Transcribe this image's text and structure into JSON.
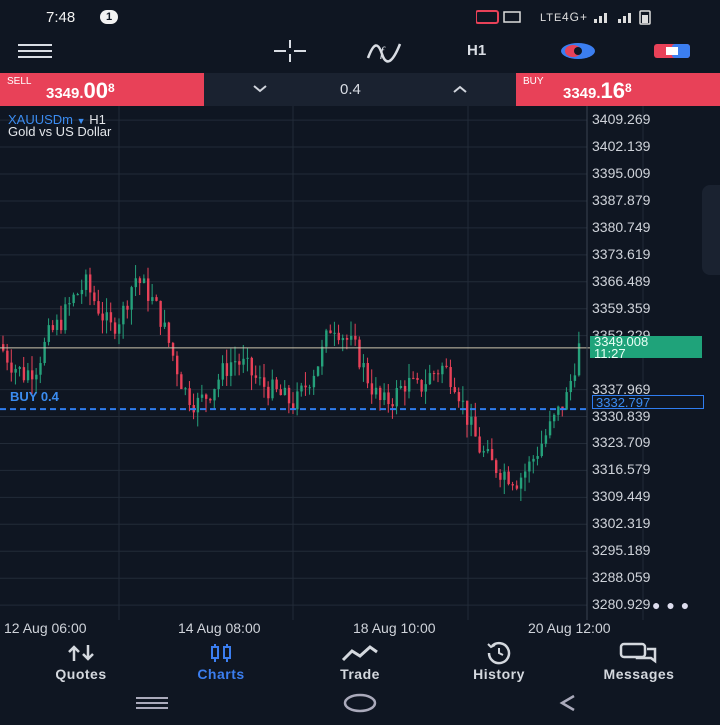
{
  "status_bar": {
    "time": "7:48",
    "notification_count": "1",
    "network": "4G+"
  },
  "toolbar": {
    "timeframe": "H1"
  },
  "trade_bar": {
    "sell_label": "SELL",
    "sell_price_main": "3349.",
    "sell_price_big": "00",
    "sell_price_sup": "8",
    "buy_label": "BUY",
    "buy_price_main": "3349.",
    "buy_price_big": "16",
    "buy_price_sup": "8",
    "volume": "0.4",
    "sell_color": "#e84158",
    "buy_color": "#e84158"
  },
  "chart": {
    "symbol": "XAUUSDm",
    "timeframe": "H1",
    "description": "Gold vs US Dollar",
    "current_price": "3349.008",
    "countdown": "11:27",
    "order_label": "BUY 0.4",
    "order_price": "3332.797",
    "y_ticks": [
      "3409.269",
      "3402.139",
      "3395.009",
      "3387.879",
      "3380.749",
      "3373.619",
      "3366.489",
      "3359.359",
      "3352.229",
      "3337.969",
      "3330.839",
      "3323.709",
      "3316.579",
      "3309.449",
      "3302.319",
      "3295.189",
      "3288.059",
      "3280.929"
    ],
    "x_ticks": [
      "12 Aug 06:00",
      "14 Aug 08:00",
      "18 Aug 10:00",
      "20 Aug 12:00"
    ],
    "up_color": "#25a17b",
    "down_color": "#e84158"
  },
  "chart_data": {
    "type": "candlestick",
    "symbol": "XAUUSDm",
    "ylim": [
      3277,
      3413
    ],
    "x": [
      "12 Aug 06:00",
      "14 Aug 08:00",
      "18 Aug 10:00",
      "20 Aug 12:00"
    ],
    "close_trace": [
      3350,
      3345,
      3342,
      3344,
      3352,
      3356,
      3362,
      3366,
      3360,
      3354,
      3358,
      3368,
      3364,
      3358,
      3348,
      3338,
      3334,
      3337,
      3342,
      3346,
      3344,
      3340,
      3338,
      3336,
      3334,
      3340,
      3346,
      3356,
      3352,
      3348,
      3340,
      3334,
      3336,
      3340,
      3338,
      3342,
      3344,
      3340,
      3330,
      3322,
      3318,
      3316,
      3314,
      3318,
      3324,
      3330,
      3336,
      3349
    ],
    "current_price": 3349.008,
    "order_line": 3332.797
  },
  "bottom_nav": {
    "items": [
      {
        "label": "Quotes",
        "icon": "quotes-icon"
      },
      {
        "label": "Charts",
        "icon": "charts-icon"
      },
      {
        "label": "Trade",
        "icon": "trade-icon"
      },
      {
        "label": "History",
        "icon": "history-icon"
      },
      {
        "label": "Messages",
        "icon": "messages-icon"
      }
    ],
    "active_color": "#3b7ef0"
  }
}
